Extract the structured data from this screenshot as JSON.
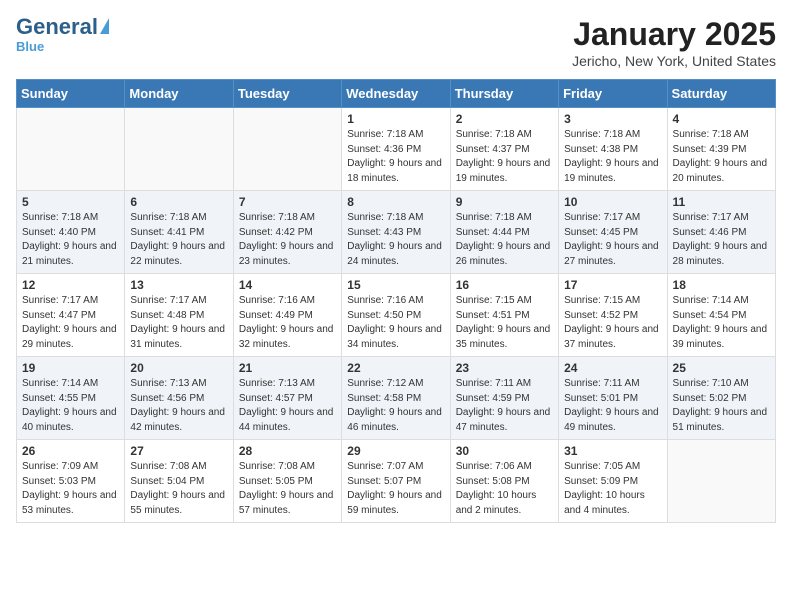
{
  "header": {
    "logo_general": "General",
    "logo_blue": "Blue",
    "month": "January 2025",
    "location": "Jericho, New York, United States"
  },
  "weekdays": [
    "Sunday",
    "Monday",
    "Tuesday",
    "Wednesday",
    "Thursday",
    "Friday",
    "Saturday"
  ],
  "weeks": [
    [
      {
        "day": "",
        "sunrise": "",
        "sunset": "",
        "daylight": ""
      },
      {
        "day": "",
        "sunrise": "",
        "sunset": "",
        "daylight": ""
      },
      {
        "day": "",
        "sunrise": "",
        "sunset": "",
        "daylight": ""
      },
      {
        "day": "1",
        "sunrise": "Sunrise: 7:18 AM",
        "sunset": "Sunset: 4:36 PM",
        "daylight": "Daylight: 9 hours and 18 minutes."
      },
      {
        "day": "2",
        "sunrise": "Sunrise: 7:18 AM",
        "sunset": "Sunset: 4:37 PM",
        "daylight": "Daylight: 9 hours and 19 minutes."
      },
      {
        "day": "3",
        "sunrise": "Sunrise: 7:18 AM",
        "sunset": "Sunset: 4:38 PM",
        "daylight": "Daylight: 9 hours and 19 minutes."
      },
      {
        "day": "4",
        "sunrise": "Sunrise: 7:18 AM",
        "sunset": "Sunset: 4:39 PM",
        "daylight": "Daylight: 9 hours and 20 minutes."
      }
    ],
    [
      {
        "day": "5",
        "sunrise": "Sunrise: 7:18 AM",
        "sunset": "Sunset: 4:40 PM",
        "daylight": "Daylight: 9 hours and 21 minutes."
      },
      {
        "day": "6",
        "sunrise": "Sunrise: 7:18 AM",
        "sunset": "Sunset: 4:41 PM",
        "daylight": "Daylight: 9 hours and 22 minutes."
      },
      {
        "day": "7",
        "sunrise": "Sunrise: 7:18 AM",
        "sunset": "Sunset: 4:42 PM",
        "daylight": "Daylight: 9 hours and 23 minutes."
      },
      {
        "day": "8",
        "sunrise": "Sunrise: 7:18 AM",
        "sunset": "Sunset: 4:43 PM",
        "daylight": "Daylight: 9 hours and 24 minutes."
      },
      {
        "day": "9",
        "sunrise": "Sunrise: 7:18 AM",
        "sunset": "Sunset: 4:44 PM",
        "daylight": "Daylight: 9 hours and 26 minutes."
      },
      {
        "day": "10",
        "sunrise": "Sunrise: 7:17 AM",
        "sunset": "Sunset: 4:45 PM",
        "daylight": "Daylight: 9 hours and 27 minutes."
      },
      {
        "day": "11",
        "sunrise": "Sunrise: 7:17 AM",
        "sunset": "Sunset: 4:46 PM",
        "daylight": "Daylight: 9 hours and 28 minutes."
      }
    ],
    [
      {
        "day": "12",
        "sunrise": "Sunrise: 7:17 AM",
        "sunset": "Sunset: 4:47 PM",
        "daylight": "Daylight: 9 hours and 29 minutes."
      },
      {
        "day": "13",
        "sunrise": "Sunrise: 7:17 AM",
        "sunset": "Sunset: 4:48 PM",
        "daylight": "Daylight: 9 hours and 31 minutes."
      },
      {
        "day": "14",
        "sunrise": "Sunrise: 7:16 AM",
        "sunset": "Sunset: 4:49 PM",
        "daylight": "Daylight: 9 hours and 32 minutes."
      },
      {
        "day": "15",
        "sunrise": "Sunrise: 7:16 AM",
        "sunset": "Sunset: 4:50 PM",
        "daylight": "Daylight: 9 hours and 34 minutes."
      },
      {
        "day": "16",
        "sunrise": "Sunrise: 7:15 AM",
        "sunset": "Sunset: 4:51 PM",
        "daylight": "Daylight: 9 hours and 35 minutes."
      },
      {
        "day": "17",
        "sunrise": "Sunrise: 7:15 AM",
        "sunset": "Sunset: 4:52 PM",
        "daylight": "Daylight: 9 hours and 37 minutes."
      },
      {
        "day": "18",
        "sunrise": "Sunrise: 7:14 AM",
        "sunset": "Sunset: 4:54 PM",
        "daylight": "Daylight: 9 hours and 39 minutes."
      }
    ],
    [
      {
        "day": "19",
        "sunrise": "Sunrise: 7:14 AM",
        "sunset": "Sunset: 4:55 PM",
        "daylight": "Daylight: 9 hours and 40 minutes."
      },
      {
        "day": "20",
        "sunrise": "Sunrise: 7:13 AM",
        "sunset": "Sunset: 4:56 PM",
        "daylight": "Daylight: 9 hours and 42 minutes."
      },
      {
        "day": "21",
        "sunrise": "Sunrise: 7:13 AM",
        "sunset": "Sunset: 4:57 PM",
        "daylight": "Daylight: 9 hours and 44 minutes."
      },
      {
        "day": "22",
        "sunrise": "Sunrise: 7:12 AM",
        "sunset": "Sunset: 4:58 PM",
        "daylight": "Daylight: 9 hours and 46 minutes."
      },
      {
        "day": "23",
        "sunrise": "Sunrise: 7:11 AM",
        "sunset": "Sunset: 4:59 PM",
        "daylight": "Daylight: 9 hours and 47 minutes."
      },
      {
        "day": "24",
        "sunrise": "Sunrise: 7:11 AM",
        "sunset": "Sunset: 5:01 PM",
        "daylight": "Daylight: 9 hours and 49 minutes."
      },
      {
        "day": "25",
        "sunrise": "Sunrise: 7:10 AM",
        "sunset": "Sunset: 5:02 PM",
        "daylight": "Daylight: 9 hours and 51 minutes."
      }
    ],
    [
      {
        "day": "26",
        "sunrise": "Sunrise: 7:09 AM",
        "sunset": "Sunset: 5:03 PM",
        "daylight": "Daylight: 9 hours and 53 minutes."
      },
      {
        "day": "27",
        "sunrise": "Sunrise: 7:08 AM",
        "sunset": "Sunset: 5:04 PM",
        "daylight": "Daylight: 9 hours and 55 minutes."
      },
      {
        "day": "28",
        "sunrise": "Sunrise: 7:08 AM",
        "sunset": "Sunset: 5:05 PM",
        "daylight": "Daylight: 9 hours and 57 minutes."
      },
      {
        "day": "29",
        "sunrise": "Sunrise: 7:07 AM",
        "sunset": "Sunset: 5:07 PM",
        "daylight": "Daylight: 9 hours and 59 minutes."
      },
      {
        "day": "30",
        "sunrise": "Sunrise: 7:06 AM",
        "sunset": "Sunset: 5:08 PM",
        "daylight": "Daylight: 10 hours and 2 minutes."
      },
      {
        "day": "31",
        "sunrise": "Sunrise: 7:05 AM",
        "sunset": "Sunset: 5:09 PM",
        "daylight": "Daylight: 10 hours and 4 minutes."
      },
      {
        "day": "",
        "sunrise": "",
        "sunset": "",
        "daylight": ""
      }
    ]
  ]
}
